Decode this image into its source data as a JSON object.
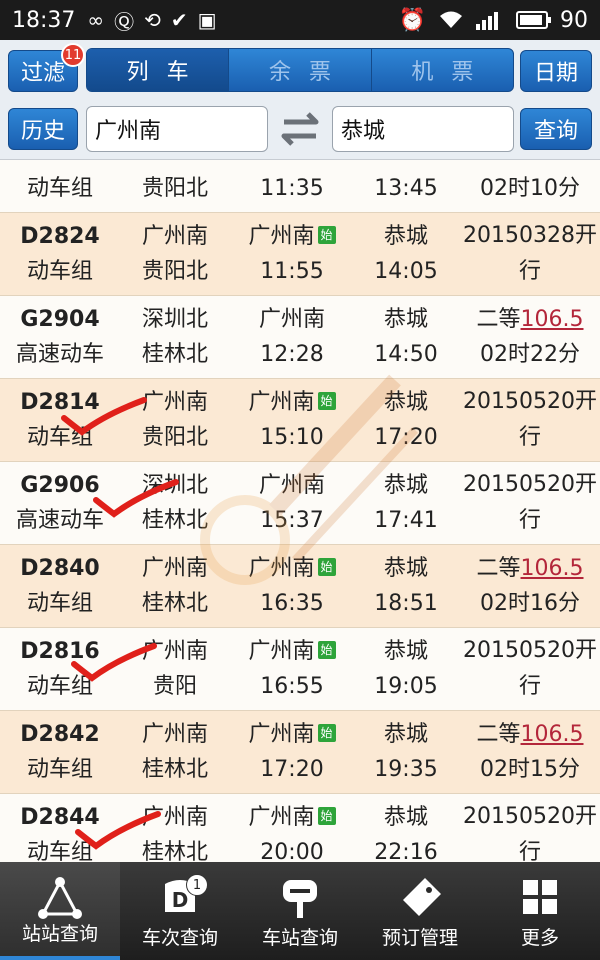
{
  "status_bar": {
    "time": "18:37",
    "battery": "90",
    "battery_level": 0.9
  },
  "toolbar": {
    "filter_label": "过滤",
    "filter_badge": "11",
    "tabs": [
      "列车",
      "余票",
      "机票"
    ],
    "date_label": "日期",
    "history_label": "历史",
    "from_station": "广州南",
    "to_station": "恭城",
    "query_label": "查询"
  },
  "trains": [
    {
      "code": "",
      "type": "动车组",
      "from": "",
      "depart_station": "贵阳北",
      "station_a": "",
      "time_a": "11:35",
      "station_b": "",
      "time_b": "13:45",
      "info1": "",
      "info2": "02时10分",
      "start": false,
      "info_kind": "price"
    },
    {
      "code": "D2824",
      "type": "动车组",
      "from": "广州南",
      "depart_station": "贵阳北",
      "station_a": "广州南",
      "time_a": "11:55",
      "station_b": "恭城",
      "time_b": "14:05",
      "info1": "20150328开",
      "info2": "行",
      "start": true,
      "info_kind": "open"
    },
    {
      "code": "G2904",
      "type": "高速动车",
      "from": "深圳北",
      "depart_station": "桂林北",
      "station_a": "广州南",
      "time_a": "12:28",
      "station_b": "恭城",
      "time_b": "14:50",
      "info1": "二等",
      "price": "106.5",
      "info2": "02时22分",
      "start": false,
      "info_kind": "price"
    },
    {
      "code": "D2814",
      "type": "动车组",
      "from": "广州南",
      "depart_station": "贵阳北",
      "station_a": "广州南",
      "time_a": "15:10",
      "station_b": "恭城",
      "time_b": "17:20",
      "info1": "20150520开",
      "info2": "行",
      "start": true,
      "info_kind": "open"
    },
    {
      "code": "G2906",
      "type": "高速动车",
      "from": "深圳北",
      "depart_station": "桂林北",
      "station_a": "广州南",
      "time_a": "15:37",
      "station_b": "恭城",
      "time_b": "17:41",
      "info1": "20150520开",
      "info2": "行",
      "start": false,
      "info_kind": "open"
    },
    {
      "code": "D2840",
      "type": "动车组",
      "from": "广州南",
      "depart_station": "桂林北",
      "station_a": "广州南",
      "time_a": "16:35",
      "station_b": "恭城",
      "time_b": "18:51",
      "info1": "二等",
      "price": "106.5",
      "info2": "02时16分",
      "start": true,
      "info_kind": "price"
    },
    {
      "code": "D2816",
      "type": "动车组",
      "from": "广州南",
      "depart_station": "贵阳",
      "station_a": "广州南",
      "time_a": "16:55",
      "station_b": "恭城",
      "time_b": "19:05",
      "info1": "20150520开",
      "info2": "行",
      "start": true,
      "info_kind": "open"
    },
    {
      "code": "D2842",
      "type": "动车组",
      "from": "广州南",
      "depart_station": "桂林北",
      "station_a": "广州南",
      "time_a": "17:20",
      "station_b": "恭城",
      "time_b": "19:35",
      "info1": "二等",
      "price": "106.5",
      "info2": "02时15分",
      "start": true,
      "info_kind": "price"
    },
    {
      "code": "D2844",
      "type": "动车组",
      "from": "广州南",
      "depart_station": "桂林北",
      "station_a": "广州南",
      "time_a": "20:00",
      "station_b": "恭城",
      "time_b": "22:16",
      "info1": "20150520开",
      "info2": "行",
      "start": true,
      "info_kind": "open"
    }
  ],
  "start_badge_label": "始",
  "bottom_nav": [
    {
      "label": "站站查询",
      "icon": "triangle-route-icon",
      "active": true
    },
    {
      "label": "车次查询",
      "icon": "train-d-icon",
      "badge": "1"
    },
    {
      "label": "车站查询",
      "icon": "station-sign-icon"
    },
    {
      "label": "预订管理",
      "icon": "ticket-tag-icon"
    },
    {
      "label": "更多",
      "icon": "grid-icon"
    }
  ],
  "colors": {
    "accent": "#2f86d6",
    "row_odd": "#fbe9d4",
    "price": "#b3263a",
    "start_badge": "#2ea43a",
    "handwritten_check": "#e0201a"
  }
}
